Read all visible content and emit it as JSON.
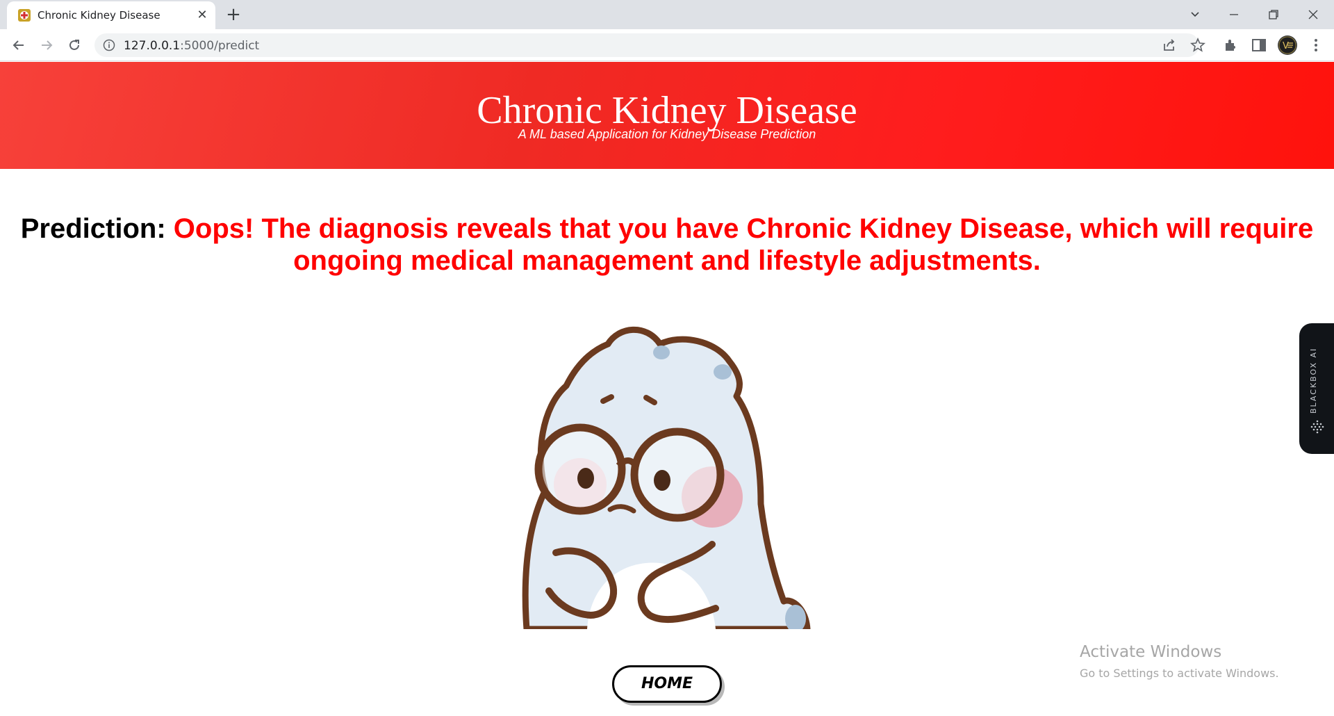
{
  "browser": {
    "tab_title": "Chronic Kidney Disease",
    "url_host": "127.0.0.1",
    "url_path": ":5000/predict"
  },
  "header": {
    "title": "Chronic Kidney Disease",
    "subtitle": "A ML based Application for Kidney Disease Prediction",
    "colors": {
      "banner_start": "#f7413a",
      "banner_end": "#ff120c"
    }
  },
  "prediction": {
    "label": "Prediction: ",
    "text": "Oops! The diagnosis reveals that you have Chronic Kidney Disease, which will require ongoing medical management and lifestyle adjustments.",
    "color": "#ff0000"
  },
  "home_button": {
    "label": "HOME"
  },
  "side_widget": {
    "label": "BLACKBOX AI"
  },
  "watermark": {
    "title": "Activate Windows",
    "subtitle": "Go to Settings to activate Windows."
  }
}
